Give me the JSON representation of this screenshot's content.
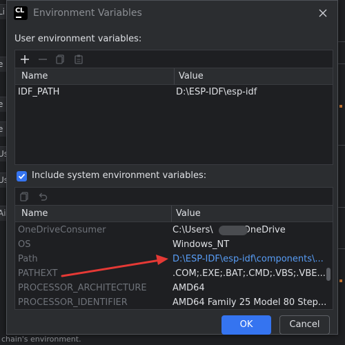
{
  "dialog": {
    "title": "Environment Variables",
    "app_icon_text": "CL"
  },
  "user_vars": {
    "label": "User environment variables:",
    "headers": {
      "name": "Name",
      "value": "Value"
    },
    "rows": [
      {
        "name": "IDF_PATH",
        "value": "D:\\ESP-IDF\\esp-idf"
      }
    ]
  },
  "system_vars": {
    "checkbox_label": "Include system environment variables:",
    "checked": true,
    "headers": {
      "name": "Name",
      "value": "Value"
    },
    "rows": [
      {
        "name": "OneDriveConsumer",
        "value_prefix": "C:\\Users\\",
        "value_suffix": "OneDrive"
      },
      {
        "name": "OS",
        "value": "Windows_NT"
      },
      {
        "name": "Path",
        "value": "D:\\ESP-IDF\\esp-idf\\components\\..."
      },
      {
        "name": "PATHEXT",
        "value": ".COM;.EXE;.BAT;.CMD;.VBS;.VBE..."
      },
      {
        "name": "PROCESSOR_ARCHITECTURE",
        "value": "AMD64"
      },
      {
        "name": "PROCESSOR_IDENTIFIER",
        "value": "AMD64 Family 25 Model 80 Step..."
      }
    ]
  },
  "buttons": {
    "ok": "OK",
    "cancel": "Cancel"
  },
  "background": {
    "left_fragments": [
      "Li",
      "e",
      "e",
      "e",
      "Us",
      "Us",
      "Ai"
    ],
    "bottom_text": "chain's environment."
  },
  "colors": {
    "accent": "#3574f0",
    "link": "#589df6",
    "annotation_arrow": "#e53935"
  }
}
